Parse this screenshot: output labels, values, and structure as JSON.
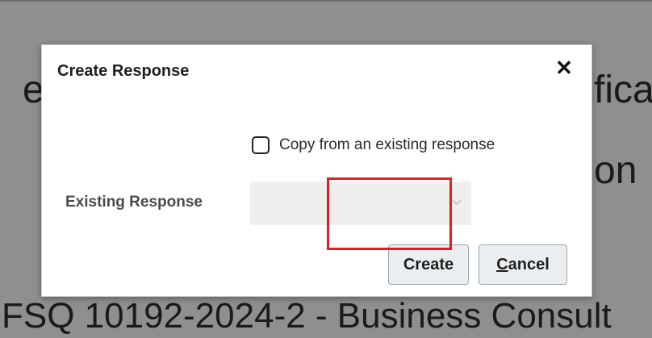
{
  "background": {
    "fragment_left": "e",
    "fragment_right_top": "fica",
    "fragment_right_mid": "on",
    "footer_text": "FSQ 10192-2024-2 - Business Consult"
  },
  "dialog": {
    "title": "Create Response",
    "close_glyph": "✕",
    "copy_checkbox_label": "Copy from an existing response",
    "copy_checked": false,
    "existing_response_label": "Existing Response",
    "existing_response_value": "",
    "create_label": "Create",
    "cancel_first": "C",
    "cancel_rest": "ancel"
  },
  "colors": {
    "overlay": "#8f8f8f",
    "dialog_bg": "#ffffff",
    "button_bg": "#ebeef0",
    "highlight": "#e02020"
  },
  "icons": {
    "close": "close-icon",
    "dropdown": "chevron-down-icon"
  }
}
